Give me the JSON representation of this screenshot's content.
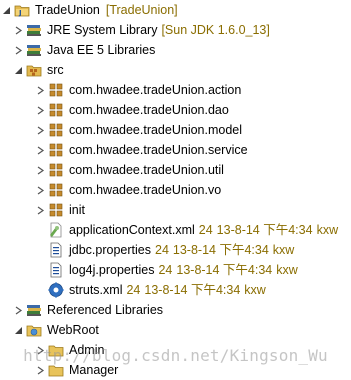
{
  "tree": {
    "project": {
      "label": "TradeUnion",
      "decoration": "[TradeUnion]"
    },
    "jre": {
      "label": "JRE System Library",
      "decoration": "[Sun JDK 1.6.0_13]"
    },
    "javaee": {
      "label": "Java EE 5 Libraries"
    },
    "src": {
      "label": "src"
    },
    "packages": [
      "com.hwadee.tradeUnion.action",
      "com.hwadee.tradeUnion.dao",
      "com.hwadee.tradeUnion.model",
      "com.hwadee.tradeUnion.service",
      "com.hwadee.tradeUnion.util",
      "com.hwadee.tradeUnion.vo",
      "init"
    ],
    "files": [
      {
        "name": "applicationContext.xml",
        "rev": "24",
        "date": "13-8-14 下午4:34",
        "author": "kxw"
      },
      {
        "name": "jdbc.properties",
        "rev": "24",
        "date": "13-8-14 下午4:34",
        "author": "kxw"
      },
      {
        "name": "log4j.properties",
        "rev": "24",
        "date": "13-8-14 下午4:34",
        "author": "kxw"
      },
      {
        "name": "struts.xml",
        "rev": "24",
        "date": "13-8-14 下午4:34",
        "author": "kxw"
      }
    ],
    "referenced": {
      "label": "Referenced Libraries"
    },
    "webroot": {
      "label": "WebRoot"
    },
    "webroot_children": [
      "Admin",
      "Manager"
    ]
  },
  "watermark": "http://blog.csdn.net/Kingson_Wu",
  "colors": {
    "decoration": "#8a6d00",
    "folder": "#e8c35a",
    "package": "#c58a2c"
  },
  "icons": {
    "project": "java-project-icon",
    "library": "library-icon",
    "src": "source-folder-icon",
    "package": "package-icon",
    "xml": "xml-file-icon",
    "properties": "properties-file-icon",
    "struts": "struts-config-icon",
    "folder": "folder-icon"
  }
}
